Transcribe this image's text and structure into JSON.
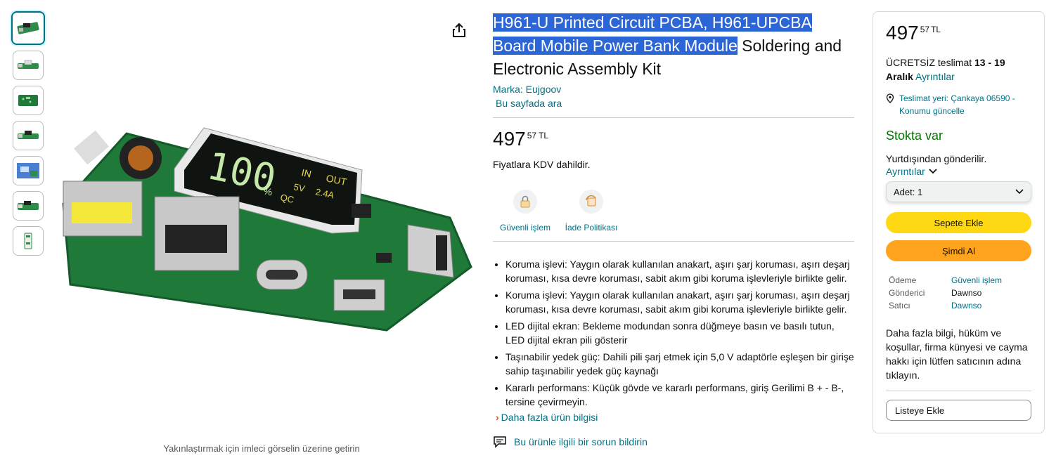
{
  "thumbnails": [
    "thumb-1",
    "thumb-2",
    "thumb-3",
    "thumb-4",
    "thumb-5",
    "thumb-6",
    "thumb-7"
  ],
  "zoom_hint": "Yakınlaştırmak için imleci görselin üzerine getirin",
  "product": {
    "title_highlighted": "H961-U Printed Circuit PCBA, H961-UPCBA Board Mobile Power Bank Module",
    "title_rest": " Soldering and Electronic Assembly Kit",
    "brand": "Marka: Eujgoov",
    "search_page": "Bu sayfada ara",
    "price_whole": "497",
    "price_fraction": "57",
    "price_currency": "TL",
    "vat_note": "Fiyatlara KDV dahildir.",
    "badges": [
      {
        "label": "Güvenli işlem",
        "icon": "lock-icon"
      },
      {
        "label": "İade Politikası",
        "icon": "return-icon"
      }
    ],
    "bullets": [
      "Koruma işlevi: Yaygın olarak kullanılan anakart, aşırı şarj koruması, aşırı deşarj koruması, kısa devre koruması, sabit akım gibi koruma işlevleriyle birlikte gelir.",
      "Koruma işlevi: Yaygın olarak kullanılan anakart, aşırı şarj koruması, aşırı deşarj koruması, kısa devre koruması, sabit akım gibi koruma işlevleriyle birlikte gelir.",
      "LED dijital ekran: Bekleme modundan sonra düğmeye basın ve basılı tutun, LED dijital ekran pili gösterir",
      "Taşınabilir yedek güç: Dahili pili şarj etmek için 5,0 V adaptörle eşleşen bir girişe sahip taşınabilir yedek güç kaynağı",
      "Kararlı performans: Küçük gövde ve kararlı performans, giriş Gerilimi B + - B-, tersine çevirmeyin."
    ],
    "more_info": "Daha fazla ürün bilgisi",
    "report": "Bu ürünle ilgili bir sorun bildirin"
  },
  "display": {
    "digits": "100",
    "in_label": "IN",
    "out_label": "OUT",
    "v_label": "5V",
    "a_label": "2.4A",
    "qc_label": "QC",
    "percent": "%"
  },
  "buybox": {
    "price_whole": "497",
    "price_fraction": "57",
    "price_currency": "TL",
    "delivery_prefix": "ÜCRETSİZ teslimat ",
    "delivery_dates": "13 - 19 Aralık",
    "delivery_details": " Ayrıntılar",
    "location": "Teslimat yeri: Çankaya 06590 - Konumu güncelle",
    "stock": "Stokta var",
    "ships_from": "Yurtdışından gönderilir.",
    "details": "Ayrıntılar",
    "quantity": "Adet:  1",
    "add_to_cart": "Sepete Ekle",
    "buy_now": "Şimdi Al",
    "info": [
      {
        "key": "Ödeme",
        "value": "Güvenli işlem",
        "link": true
      },
      {
        "key": "Gönderici",
        "value": "Dawnso",
        "link": false
      },
      {
        "key": "Satıcı",
        "value": "Dawnso",
        "link": true
      }
    ],
    "more_text": "Daha fazla bilgi, hüküm ve koşullar, firma künyesi ve cayma hakkı için lütfen satıcının adına tıklayın.",
    "add_to_list": "Listeye Ekle"
  },
  "colors": {
    "link": "#007185",
    "stock": "#007600",
    "cart": "#ffd814",
    "buy": "#ffa41c",
    "highlight": "#2b65d6",
    "pcb": "#1f7a3a"
  }
}
